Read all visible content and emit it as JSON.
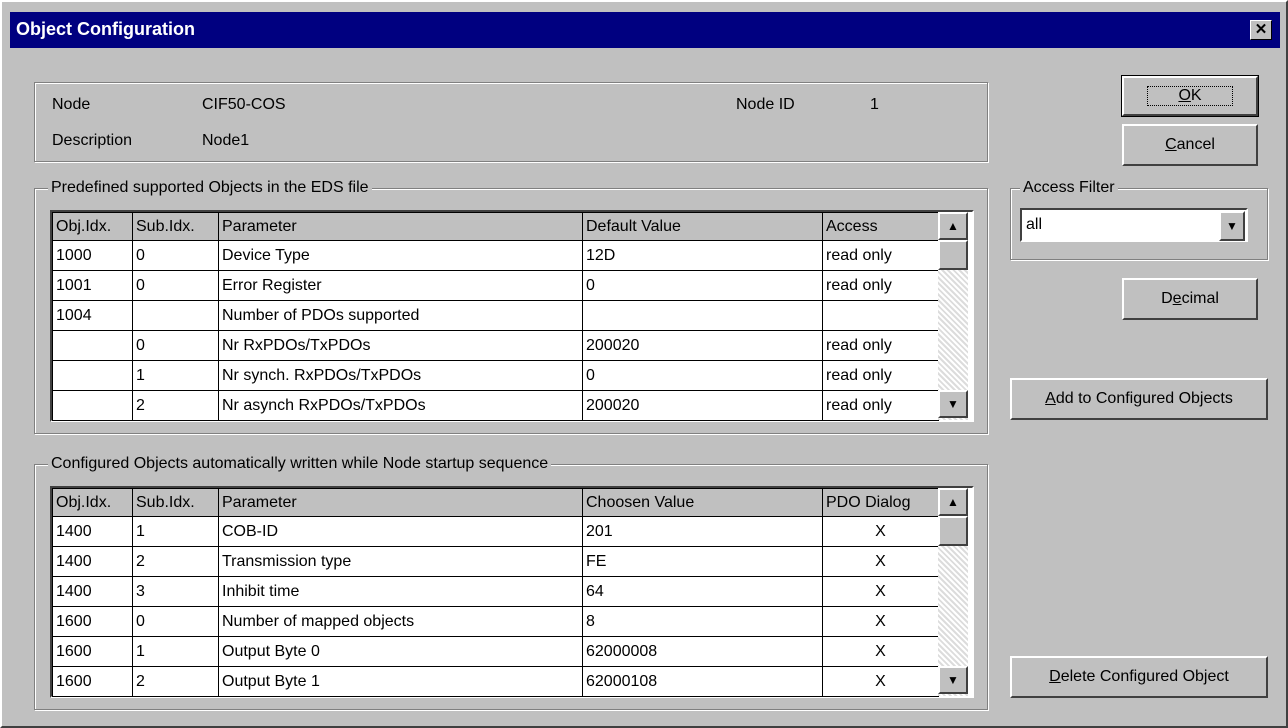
{
  "window": {
    "title": "Object Configuration",
    "close_glyph": "✕"
  },
  "node_info": {
    "node_label": "Node",
    "node_value": "CIF50-COS",
    "node_id_label": "Node ID",
    "node_id_value": "1",
    "description_label": "Description",
    "description_value": "Node1"
  },
  "buttons": {
    "ok": {
      "prefix": "",
      "mnemonic": "O",
      "suffix": "K"
    },
    "cancel": {
      "prefix": "",
      "mnemonic": "C",
      "suffix": "ancel"
    },
    "decimal": {
      "prefix": "D",
      "mnemonic": "e",
      "suffix": "cimal"
    },
    "add_configured": {
      "prefix": "",
      "mnemonic": "A",
      "suffix": "dd to Configured Objects"
    },
    "delete_configured": {
      "prefix": "",
      "mnemonic": "D",
      "suffix": "elete Configured Object"
    }
  },
  "access_filter": {
    "label": "Access Filter",
    "value": "all"
  },
  "predefined": {
    "title": "Predefined supported Objects in the EDS file",
    "columns": [
      "Obj.Idx.",
      "Sub.Idx.",
      "Parameter",
      "Default Value",
      "Access"
    ],
    "rows": [
      [
        "1000",
        "0",
        "Device Type",
        "12D",
        "read only"
      ],
      [
        "1001",
        "0",
        "Error Register",
        "0",
        "read only"
      ],
      [
        "1004",
        "",
        "Number of PDOs supported",
        "",
        ""
      ],
      [
        "",
        "0",
        "Nr RxPDOs/TxPDOs",
        "200020",
        "read only"
      ],
      [
        "",
        "1",
        "Nr synch. RxPDOs/TxPDOs",
        "0",
        "read only"
      ],
      [
        "",
        "2",
        "Nr asynch RxPDOs/TxPDOs",
        "200020",
        "read only"
      ]
    ]
  },
  "configured": {
    "title": "Configured Objects automatically written while Node startup sequence",
    "columns": [
      "Obj.Idx.",
      "Sub.Idx.",
      "Parameter",
      "Choosen Value",
      "PDO Dialog"
    ],
    "rows": [
      [
        "1400",
        "1",
        "COB-ID",
        "201",
        "X"
      ],
      [
        "1400",
        "2",
        "Transmission type",
        "FE",
        "X"
      ],
      [
        "1400",
        "3",
        "Inhibit time",
        "64",
        "X"
      ],
      [
        "1600",
        "0",
        "Number of mapped objects",
        "8",
        "X"
      ],
      [
        "1600",
        "1",
        "Output Byte 0",
        "62000008",
        "X"
      ],
      [
        "1600",
        "2",
        "Output Byte 1",
        "62000108",
        "X"
      ]
    ]
  },
  "icons": {
    "scroll_up": "▲",
    "scroll_down": "▼",
    "combo_down": "▼"
  }
}
